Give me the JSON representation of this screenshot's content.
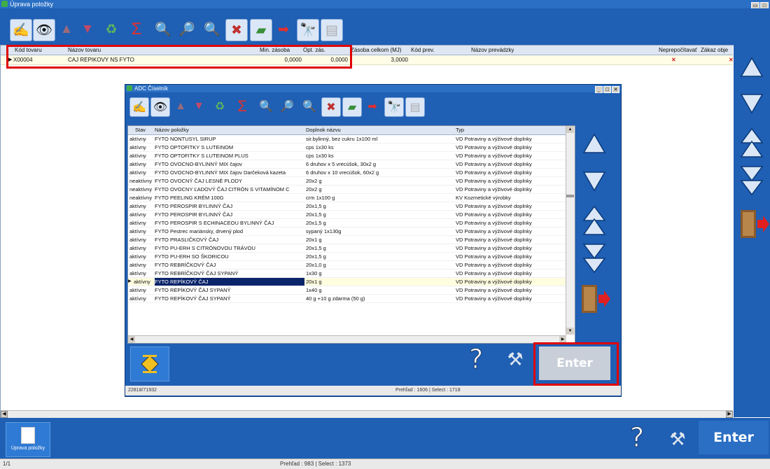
{
  "window": {
    "title": "Úprava položky"
  },
  "main_grid": {
    "columns": [
      "Kód tovaru",
      "Názov tovaru",
      "Min. zásoba",
      "Opt. zás.",
      "Zásoba celkom (MJ)",
      "Kód prev.",
      "Názov prevádzky",
      "Neprepočítavať",
      "Zákaz obje"
    ],
    "row": {
      "kod": "X00004",
      "nazov": "CAJ REPIKOVY NS  FYTO",
      "min": "0,0000",
      "opt": "0,0000",
      "zasoba": "3,0000",
      "kod_prev": "",
      "nazov_prev": "",
      "neprepocitavat": "✕",
      "zakaz": "✕"
    }
  },
  "dialog": {
    "title": "ADC Číselník",
    "columns": [
      "Stav",
      "Názov položky",
      "Doplnok názvu",
      "Typ"
    ],
    "rows": [
      [
        "aktívny",
        "FYTO NONTUSYL SIRUP",
        "sir.bylinný, bez cukru 1x100 ml",
        "VD Potraviny a výživové doplnky"
      ],
      [
        "aktívny",
        "FYTO OPTOFITKY S LUTEINOM",
        "cps 1x30 ks",
        "VD Potraviny a výživové doplnky"
      ],
      [
        "aktívny",
        "FYTO OPTOFITKY S LUTEINOM PLUS",
        "cps 1x30 ks",
        "VD Potraviny a výživové doplnky"
      ],
      [
        "aktívny",
        "FYTO OVOCNO-BYLINNÝ MIX čajov",
        "6 druhov x 5 vrecúšok, 30x2 g",
        "VD Potraviny a výživové doplnky"
      ],
      [
        "aktívny",
        "FYTO OVOCNO-BYLINNÝ MIX čajov Darčeková kazeta",
        "6 druhov x 10 vrecúšok, 60x2 g",
        "VD Potraviny a výživové doplnky"
      ],
      [
        "neaktívny",
        "FYTO OVOCNÝ ČAJ LESNÉ PLODY",
        "20x2 g",
        "VD Potraviny a výživové doplnky"
      ],
      [
        "neaktívny",
        "FYTO OVOCNY ĽADOVÝ ČAJ CITRÓN S VITAMÍNOM  C",
        "20x2 g",
        "VD Potraviny a výživové doplnky"
      ],
      [
        "neaktívny",
        "FYTO PEELING KRÉM 100G",
        "crm 1x100 g",
        "KV Kozmetické výrobky"
      ],
      [
        "aktívny",
        "FYTO PEROSPIR BYLINNÝ ČAJ",
        "20x1,5 g",
        "VD Potraviny a výživové doplnky"
      ],
      [
        "aktívny",
        "FYTO PEROSPIR BYLINNÝ ČAJ",
        "20x1,5 g",
        "VD Potraviny a výživové doplnky"
      ],
      [
        "aktívny",
        "FYTO PEROSPIR S ECHINACEOU BYLINNÝ ČAJ",
        "20x1,5 g",
        "VD Potraviny a výživové doplnky"
      ],
      [
        "aktívny",
        "FYTO Pestrec mariánsky, drvený plod",
        "sypaný 1x130g",
        "VD Potraviny a výživové doplnky"
      ],
      [
        "aktívny",
        "FYTO PRASLIČKOVÝ ČAJ",
        "20x1 g",
        "VD Potraviny a výživové doplnky"
      ],
      [
        "aktívny",
        "FYTO PU-ERH S CITRÓNOVOU TRÁVOU",
        "20x1,5 g",
        "VD Potraviny a výživové doplnky"
      ],
      [
        "aktívny",
        "FYTO PU-ERH SO ŠKORICOU",
        "20x1,5 g",
        "VD Potraviny a výživové doplnky"
      ],
      [
        "aktívny",
        "FYTO REBRÍČKOVÝ ČAJ",
        "20x1,0 g",
        "VD Potraviny a výživové doplnky"
      ],
      [
        "aktívny",
        "FYTO REBRÍČKOVÝ ČAJ SYPANÝ",
        "1x30 g",
        "VD Potraviny a výživové doplnky"
      ],
      [
        "aktívny",
        "FYTO REPÍKOVÝ ČAJ",
        "20x1 g",
        "VD Potraviny a výživové doplnky"
      ],
      [
        "aktívny",
        "FYTO REPÍKOVÝ ČAJ SYPANÝ",
        "1x40 g",
        "VD Potraviny a výživové doplnky"
      ],
      [
        "aktívny",
        "FYTO REPÍKOVÝ ČAJ SYPANÝ",
        "40 g +10 g zdarma (50 g)",
        "VD Potraviny a výživové doplnky"
      ]
    ],
    "status_left": "22818/71932",
    "status_center": "Prehľad : 1606 | Select : 1718",
    "enter_label": "Enter"
  },
  "bottom": {
    "module_label": "Úprava položky",
    "enter_label": "Enter",
    "status_left": "1/1",
    "status_center": "Prehľad : 983 | Select : 1373"
  },
  "colors": {
    "bar": "#1f5fb4",
    "highlight": "#e00000",
    "selected_row": "#0a246a"
  }
}
